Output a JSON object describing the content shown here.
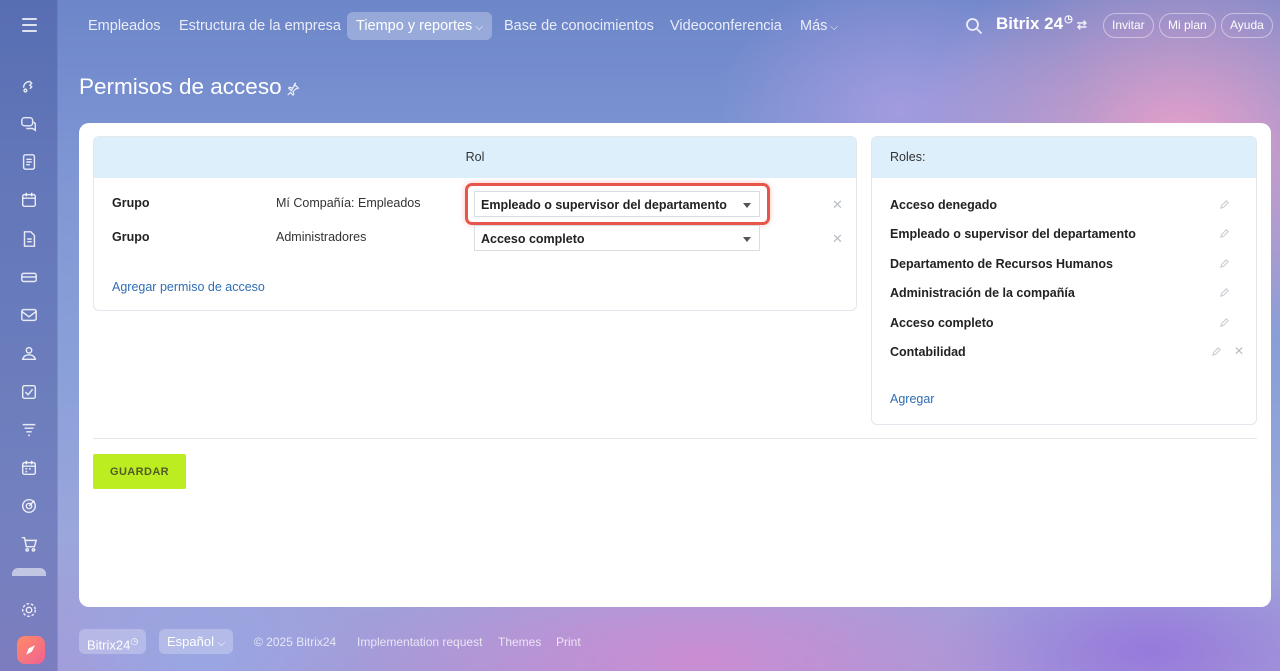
{
  "topnav": {
    "items": [
      {
        "label": "Empleados"
      },
      {
        "label": "Estructura de la empresa"
      },
      {
        "label": "Tiempo y reportes",
        "active": true
      },
      {
        "label": "Base de conocimientos"
      },
      {
        "label": "Videoconferencia"
      },
      {
        "label": "Más"
      }
    ],
    "brand": "Bitrix 24",
    "invite": "Invitar",
    "my_plan": "Mi plan",
    "help": "Ayuda"
  },
  "page": {
    "title": "Permisos de acceso"
  },
  "access_panel": {
    "header": "Rol",
    "rows": [
      {
        "type": "Grupo",
        "entity": "Mí Compañía: Empleados",
        "role": "Empleado o supervisor del departamento"
      },
      {
        "type": "Grupo",
        "entity": "Administradores",
        "role": "Acceso completo"
      }
    ],
    "add_link": "Agregar permiso de acceso"
  },
  "roles_panel": {
    "header": "Roles:",
    "items": [
      {
        "label": "Acceso denegado"
      },
      {
        "label": "Empleado o supervisor del departamento"
      },
      {
        "label": "Departamento de Recursos Humanos"
      },
      {
        "label": "Administración de la compañía"
      },
      {
        "label": "Acceso completo"
      },
      {
        "label": "Contabilidad"
      }
    ],
    "add_link": "Agregar"
  },
  "actions": {
    "save": "GUARDAR"
  },
  "footer": {
    "brand": "Bitrix24",
    "language": "Español",
    "copyright": "© 2025 Bitrix24",
    "implementation": "Implementation request",
    "themes": "Themes",
    "print": "Print"
  },
  "colors": {
    "accent_link": "#2f6eb5",
    "save_button": "#bbed21",
    "panel_header": "#dceffb",
    "highlight_border": "#e6574a"
  },
  "icons": {
    "sidebar": [
      "menu-icon",
      "feed-icon",
      "chat-icon",
      "tasks-icon",
      "calendar-icon",
      "documents-icon",
      "drive-icon",
      "mail-icon",
      "contacts-icon",
      "checklist-icon",
      "filter-icon",
      "planner-icon",
      "goals-icon",
      "cart-icon",
      "settings-icon",
      "copilot-icon"
    ]
  }
}
